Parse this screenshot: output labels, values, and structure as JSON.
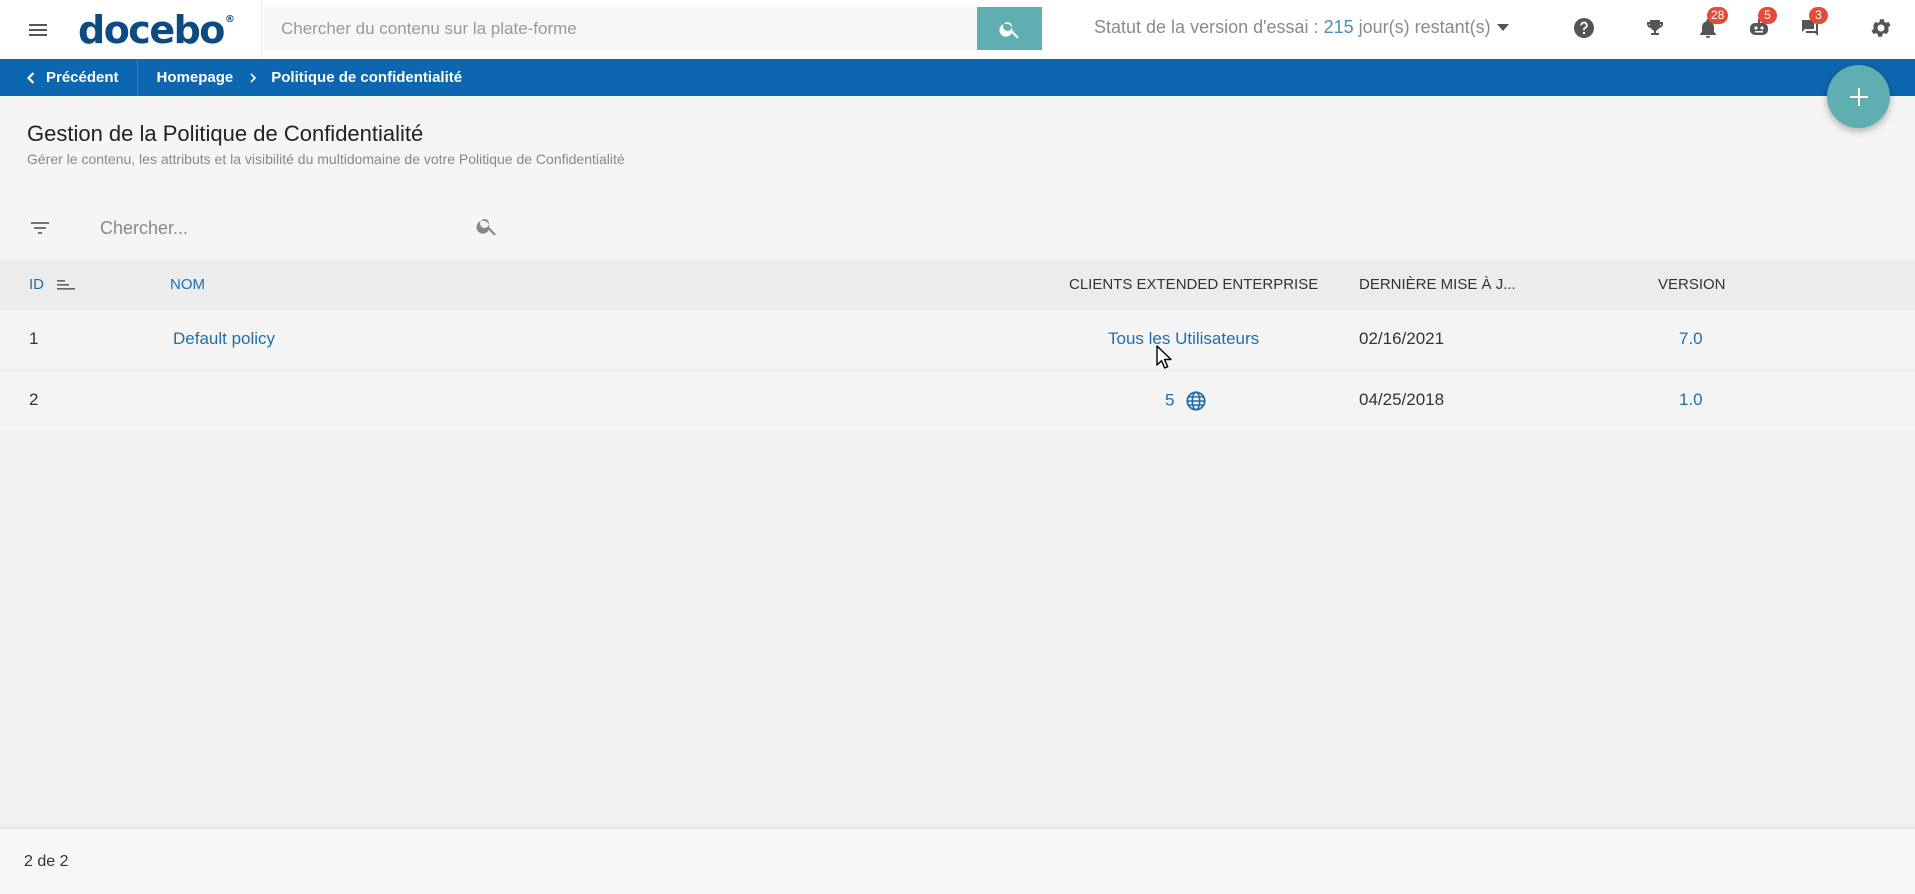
{
  "header": {
    "logo_text": "docebo",
    "logo_mark": "®",
    "search_placeholder": "Chercher du contenu sur la plate-forme",
    "trial_prefix": "Statut de la version d'essai :",
    "trial_days": "215",
    "trial_suffix": "jour(s) restant(s)",
    "badges": {
      "notifications": "28",
      "coach": "5",
      "messages": "3"
    }
  },
  "breadcrumb": {
    "back_label": "Précédent",
    "home_label": "Homepage",
    "current_label": "Politique de confidentialité"
  },
  "page": {
    "title": "Gestion de la Politique de Confidentialité",
    "subtitle": "Gérer le contenu, les attributs et la visibilité du multidomaine de votre Politique de Confidentialité",
    "filter_placeholder": "Chercher..."
  },
  "table": {
    "columns": {
      "id": "ID",
      "name": "NOM",
      "clients": "CLIENTS EXTENDED ENTERPRISE",
      "updated": "DERNIÈRE MISE À J...",
      "version": "VERSION"
    },
    "rows": [
      {
        "id": "1",
        "name": "Default policy",
        "clients": "Tous les Utilisateurs",
        "updated": "02/16/2021",
        "version": "7.0"
      },
      {
        "id": "2",
        "name": "",
        "clients": "5",
        "updated": "04/25/2018",
        "version": "1.0"
      }
    ]
  },
  "footer": {
    "count_label": "2 de 2"
  },
  "colors": {
    "brand_blue": "#0c66b0",
    "teal": "#5eaeb2",
    "link": "#1f6fae",
    "badge_red": "#e24c3b"
  }
}
